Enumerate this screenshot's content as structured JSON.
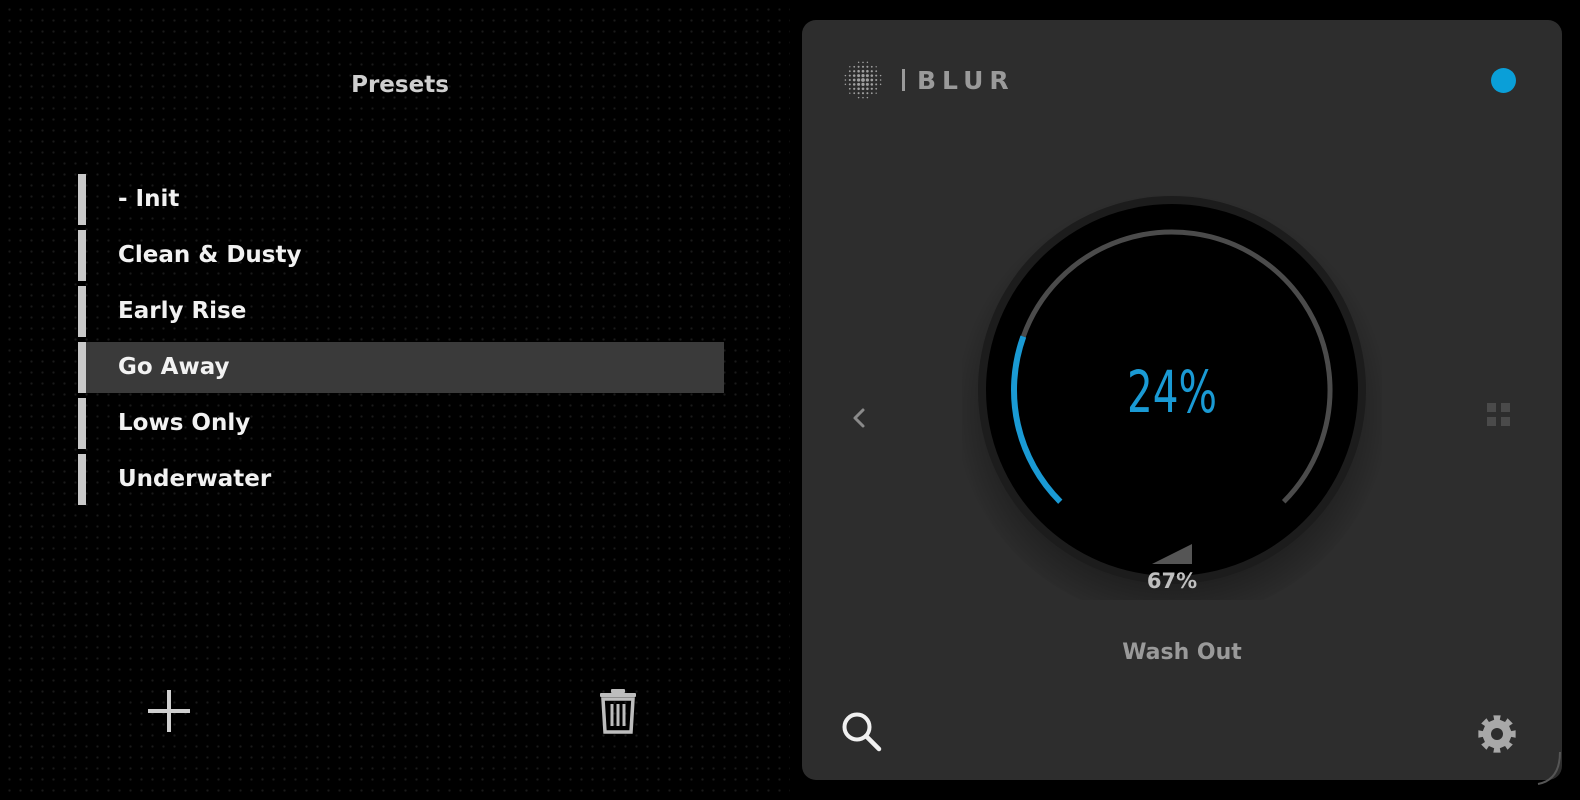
{
  "presets_panel": {
    "title": "Presets",
    "items": [
      {
        "label": "- Init",
        "selected": false
      },
      {
        "label": "Clean & Dusty",
        "selected": false
      },
      {
        "label": "Early Rise",
        "selected": false
      },
      {
        "label": "Go Away",
        "selected": true
      },
      {
        "label": "Lows Only",
        "selected": false
      },
      {
        "label": "Underwater",
        "selected": false
      }
    ],
    "add_icon": "plus-icon",
    "delete_icon": "trash-icon"
  },
  "plugin": {
    "logo_text": "BLUR",
    "logo_icon": "dot-sphere-icon",
    "status_color": "#0a9fd8",
    "knob": {
      "value_text": "24%",
      "value": 0.24,
      "secondary_text": "67%",
      "secondary_value": 0.67,
      "name": "Wash Out",
      "accent_color": "#1a9ad4"
    },
    "prev_icon": "chevron-left-icon",
    "grid_icon": "grid-icon",
    "search_icon": "search-icon",
    "settings_icon": "gear-icon"
  }
}
